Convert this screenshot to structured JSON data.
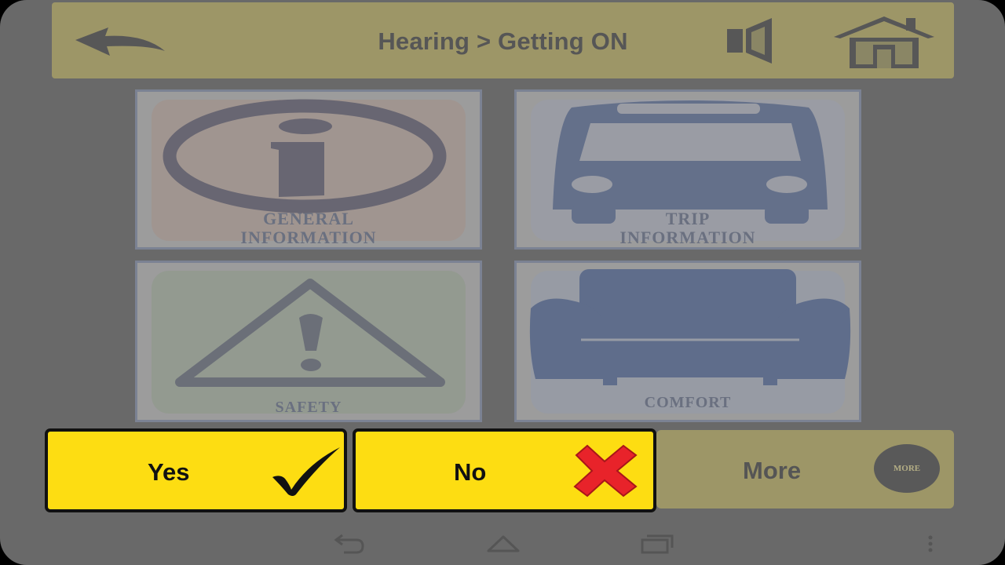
{
  "header": {
    "title": "Hearing > Getting ON",
    "icons": [
      "back-arrow-icon",
      "speaker-icon",
      "home-icon"
    ]
  },
  "tiles": [
    {
      "line1": "GENERAL",
      "line2": "INFORMATION",
      "icon": "info-icon"
    },
    {
      "line1": "TRIP",
      "line2": "INFORMATION",
      "icon": "bus-icon"
    },
    {
      "label": "SAFETY",
      "icon": "warning-icon"
    },
    {
      "label": "COMFORT",
      "icon": "armchair-icon"
    }
  ],
  "actions": {
    "yes_label": "Yes",
    "no_label": "No",
    "more_label": "More",
    "more_badge": "MORE"
  },
  "colors": {
    "background": "#696969",
    "header": "#9d9667",
    "yes_no": "#fddd12",
    "no_x": "#e8232a"
  },
  "navbar": {
    "icons": [
      "nav-back-icon",
      "nav-home-icon",
      "nav-recents-icon",
      "nav-menu-icon"
    ]
  }
}
